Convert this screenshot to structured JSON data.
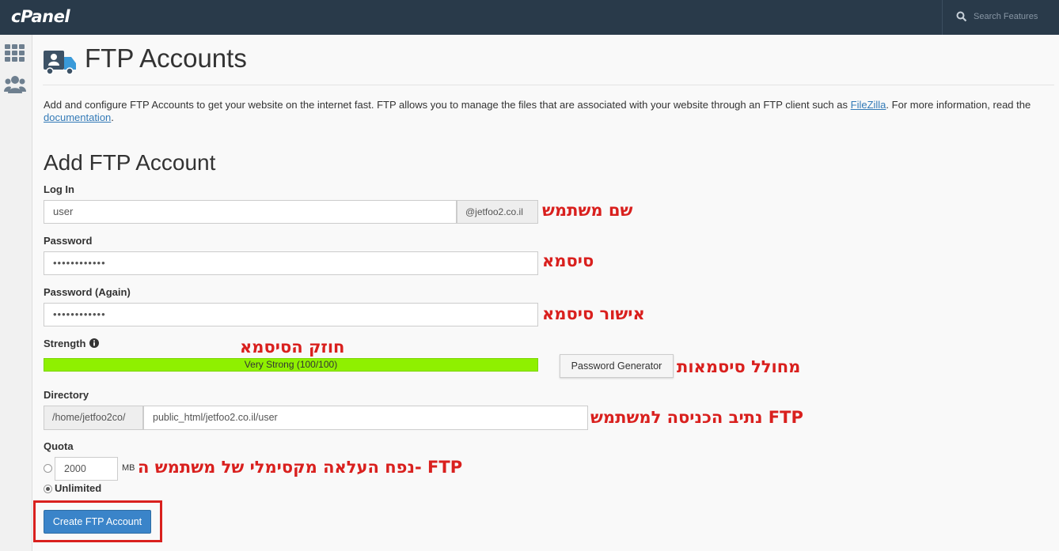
{
  "topbar": {
    "logo": "cPanel",
    "search_placeholder": "Search Features"
  },
  "sidebar": {
    "items": [
      {
        "icon": "grid-icon"
      },
      {
        "icon": "users-icon"
      }
    ]
  },
  "page": {
    "title": "FTP Accounts",
    "description_before": "Add and configure FTP Accounts to get your website on the internet fast. FTP allows you to manage the files that are associated with your website through an FTP client such as ",
    "filezilla_link": "FileZilla",
    "description_middle": ". For more information, read the ",
    "documentation_link": "documentation",
    "description_after": "."
  },
  "form": {
    "section_title": "Add FTP Account",
    "login_label": "Log In",
    "login_value": "user",
    "domain_suffix": "@jetfoo2.co.il",
    "password_label": "Password",
    "password_value": "••••••••••••",
    "password_again_label": "Password (Again)",
    "password_again_value": "••••••••••••",
    "strength_label": "Strength",
    "strength_text": "Very Strong (100/100)",
    "strength_score": 100,
    "password_generator": "Password Generator",
    "directory_label": "Directory",
    "directory_prefix": "/home/jetfoo2co/",
    "directory_value": "public_html/jetfoo2.co.il/user",
    "quota_label": "Quota",
    "quota_value": "2000",
    "quota_unit": "MB",
    "unlimited_label": "Unlimited",
    "quota_selected": "Unlimited",
    "create_button": "Create FTP Account"
  },
  "annotations": {
    "username": "שם משתמש",
    "password": "סיסמא",
    "confirm_password": "אישור סיסמא",
    "strength": "חוזק הסיסמא",
    "generator": "מחולל סיסמאות",
    "directory": "נתיב הכניסה למשתמש FTP",
    "quota": "נפח העלאה מקסימלי של משתמש ה- FTP"
  },
  "colors": {
    "topbar": "#293a4a",
    "strength": "#8ff000",
    "button": "#3a84c9",
    "annotation": "#d9201e"
  }
}
